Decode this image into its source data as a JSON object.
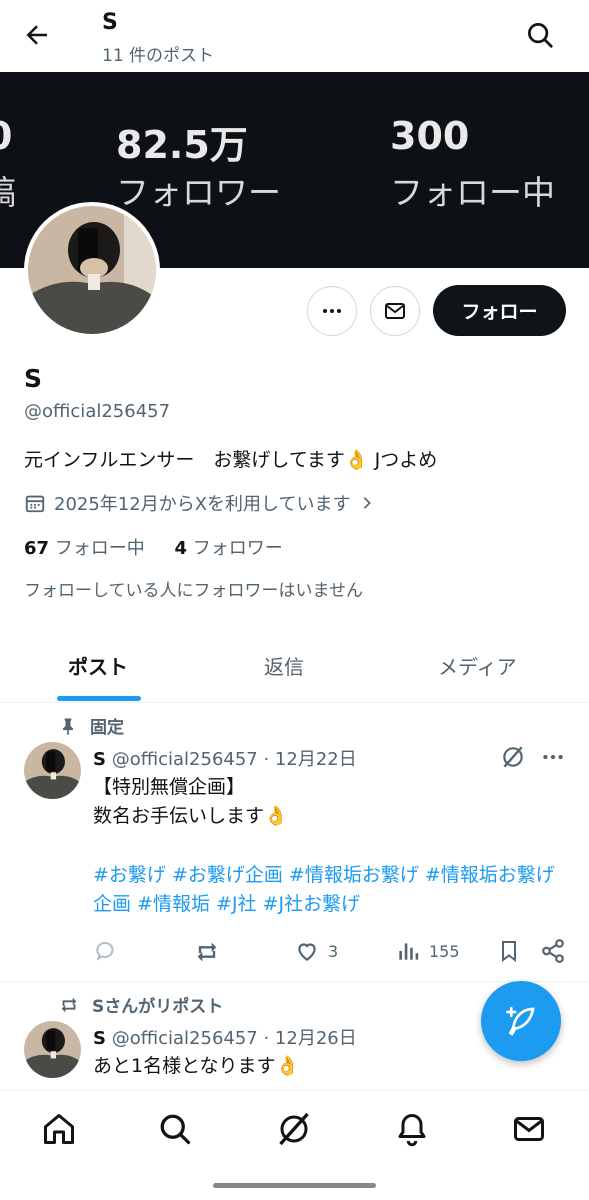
{
  "header": {
    "title": "S",
    "post_count": "11 件のポスト"
  },
  "banner": {
    "partial_number": "0",
    "partial_label": "稿",
    "followers_number": "82.5万",
    "followers_label": "フォロワー",
    "following_number": "300",
    "following_label": "フォロー中",
    "background_color": "#0d1014"
  },
  "profile": {
    "name": "S",
    "handle": "@official256457",
    "bio": "元インフルエンサー　お繋げしてます👌 Jつよめ",
    "joined": "2025年12月からXを利用しています",
    "following_count": "67",
    "following_label": "フォロー中",
    "followers_count": "4",
    "followers_label": "フォロワー",
    "no_mutual_followers": "フォローしている人にフォロワーはいません",
    "follow_button": "フォロー"
  },
  "tabs": [
    {
      "label": "ポスト",
      "active": true
    },
    {
      "label": "返信",
      "active": false
    },
    {
      "label": "メディア",
      "active": false
    }
  ],
  "posts": [
    {
      "context": "固定",
      "name": "S",
      "handle_date": "@official256457 · 12月22日",
      "lines": [
        "【特別無償企画】",
        "数名お手伝いします👌"
      ],
      "hashtags": "#お繋げ #お繋げ企画 #情報垢お繋げ #情報垢お繋げ企画 #情報垢 #J社 #J社お繋げ",
      "likes": "3",
      "views": "155"
    },
    {
      "context": "Sさんがリポスト",
      "name": "S",
      "handle_date": "@official256457 · 12月26日",
      "lines": [
        "あと1名様となります👌"
      ]
    }
  ],
  "colors": {
    "accent": "#1d9bf0",
    "text": "#0f1419",
    "secondary": "#536471",
    "border": "#cfd9de"
  },
  "nav": [
    "home-icon",
    "search-icon",
    "grok-icon",
    "bell-icon",
    "mail-icon"
  ]
}
